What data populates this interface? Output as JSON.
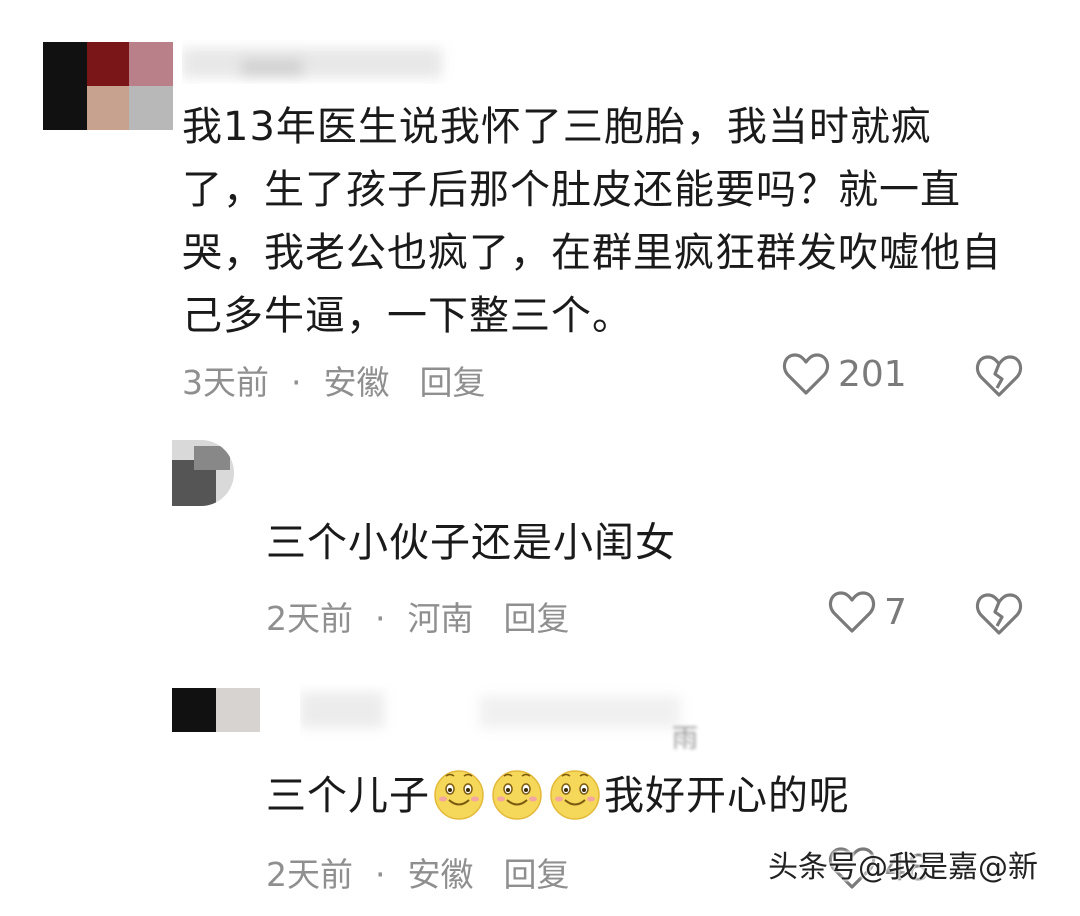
{
  "comments": [
    {
      "text": "我13年医生说我怀了三胞胎，我当时就疯了，生了孩子后那个肚皮还能要吗？就一直哭，我老公也疯了，在群里疯狂群发吹嘘他自己多牛逼，一下整三个。",
      "time": "3天前",
      "sep": "·",
      "location": "安徽",
      "reply": "回复",
      "likes": "201"
    },
    {
      "text": "三个小伙子还是小闺女",
      "time": "2天前",
      "sep": "·",
      "location": "河南",
      "reply": "回复",
      "likes": "7"
    },
    {
      "username_fragment": "雨",
      "text_before": "三个儿子",
      "text_after": "我好开心的呢",
      "emoji_count": 3,
      "emoji_icon": "smiling-face-emoji",
      "time": "2天前",
      "sep": "·",
      "location": "安徽",
      "reply": "回复",
      "likes": "48"
    }
  ],
  "watermark": "头条号@我是嘉@新",
  "icons": {
    "like": "heart-outline-icon",
    "dislike": "broken-heart-icon"
  },
  "colors": {
    "meta": "#8f8f8f",
    "text": "#1a1a1a",
    "emoji": "#f5d75a"
  }
}
